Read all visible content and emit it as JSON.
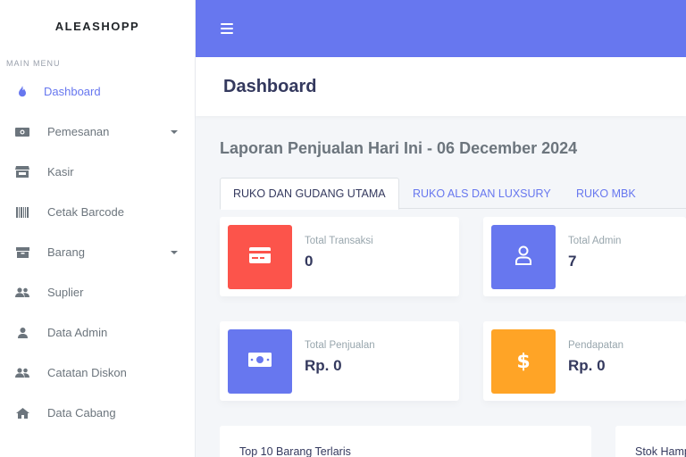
{
  "brand": "ALEASHOPP",
  "sidebar": {
    "header": "MAIN MENU",
    "items": [
      {
        "label": "Dashboard",
        "icon": "fire-icon"
      },
      {
        "label": "Pemesanan",
        "icon": "money-icon"
      },
      {
        "label": "Kasir",
        "icon": "store-icon"
      },
      {
        "label": "Cetak Barcode",
        "icon": "barcode-icon"
      },
      {
        "label": "Barang",
        "icon": "box-icon"
      },
      {
        "label": "Suplier",
        "icon": "users-icon"
      },
      {
        "label": "Data Admin",
        "icon": "user-icon"
      },
      {
        "label": "Catatan Diskon",
        "icon": "users-icon"
      },
      {
        "label": "Data Cabang",
        "icon": "home-icon"
      }
    ]
  },
  "header": {
    "title": "Dashboard"
  },
  "report": {
    "title": "Laporan Penjualan Hari Ini - 06 December 2024"
  },
  "tabs": [
    "RUKO DAN GUDANG UTAMA",
    "RUKO ALS DAN LUXSURY",
    "RUKO MBK"
  ],
  "stats": [
    {
      "label": "Total Transaksi",
      "value": "0",
      "color": "#fc544b",
      "icon": "credit-card-icon"
    },
    {
      "label": "Total Admin",
      "value": "7",
      "color": "#6777ef",
      "icon": "user-icon"
    },
    {
      "label": "Total Penjualan",
      "value": "Rp. 0",
      "color": "#6777ef",
      "icon": "money-icon"
    },
    {
      "label": "Pendapatan",
      "value": "Rp. 0",
      "color": "#ffa426",
      "icon": "dollar-icon"
    }
  ],
  "panels": {
    "top_items": "Top 10 Barang Terlaris",
    "stock": "Stok Hampir Habis"
  },
  "colors": {
    "primary": "#6777ef",
    "danger": "#fc544b",
    "warning": "#ffa426"
  }
}
